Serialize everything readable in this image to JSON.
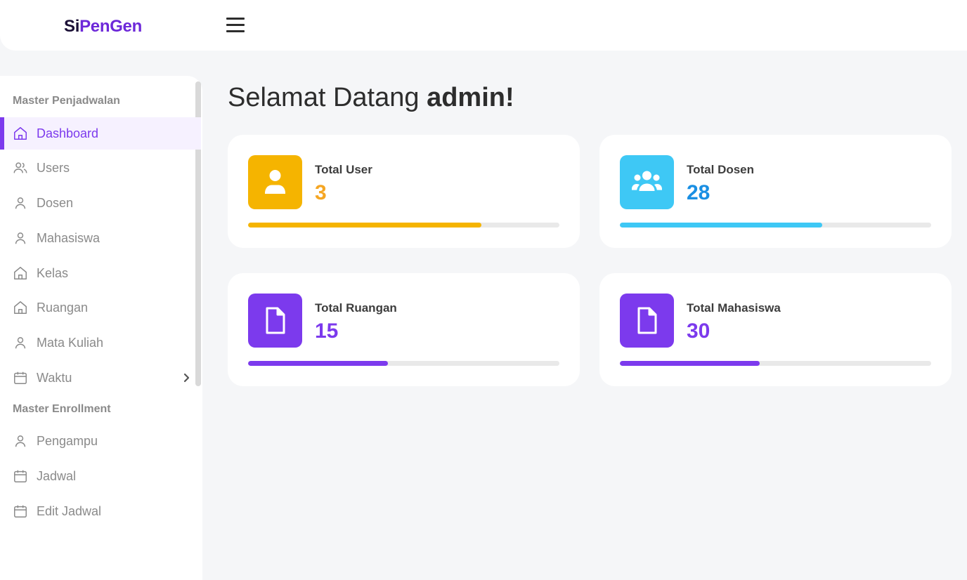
{
  "brand": {
    "part1": "Si",
    "part2": "PenGen"
  },
  "sidebar": {
    "sections": [
      {
        "title": "Master Penjadwalan"
      },
      {
        "title": "Master Enrollment"
      }
    ],
    "items": [
      {
        "label": "Dashboard",
        "icon": "home-icon"
      },
      {
        "label": "Users",
        "icon": "users-icon"
      },
      {
        "label": "Dosen",
        "icon": "user-icon"
      },
      {
        "label": "Mahasiswa",
        "icon": "user-icon"
      },
      {
        "label": "Kelas",
        "icon": "home-icon"
      },
      {
        "label": "Ruangan",
        "icon": "home-icon"
      },
      {
        "label": "Mata Kuliah",
        "icon": "user-icon"
      },
      {
        "label": "Waktu",
        "icon": "calendar-icon"
      },
      {
        "label": "Pengampu",
        "icon": "user-icon"
      },
      {
        "label": "Jadwal",
        "icon": "calendar-icon"
      },
      {
        "label": "Edit Jadwal",
        "icon": "calendar-icon"
      }
    ]
  },
  "main": {
    "welcome_prefix": "Selamat Datang",
    "welcome_user": "admin!"
  },
  "cards": [
    {
      "label": "Total User",
      "value": "3",
      "progress": 0.75,
      "color": "#f5b400",
      "value_color": "#f5a623",
      "icon": "user-icon"
    },
    {
      "label": "Total Dosen",
      "value": "28",
      "progress": 0.65,
      "color": "#3ec8f5",
      "value_color": "#1a8fe3",
      "icon": "users-group-icon"
    },
    {
      "label": "Total Ruangan",
      "value": "15",
      "progress": 0.45,
      "color": "#7c3aed",
      "value_color": "#7c3aed",
      "icon": "file-icon"
    },
    {
      "label": "Total Mahasiswa",
      "value": "30",
      "progress": 0.45,
      "color": "#7c3aed",
      "value_color": "#7c3aed",
      "icon": "file-icon"
    }
  ]
}
